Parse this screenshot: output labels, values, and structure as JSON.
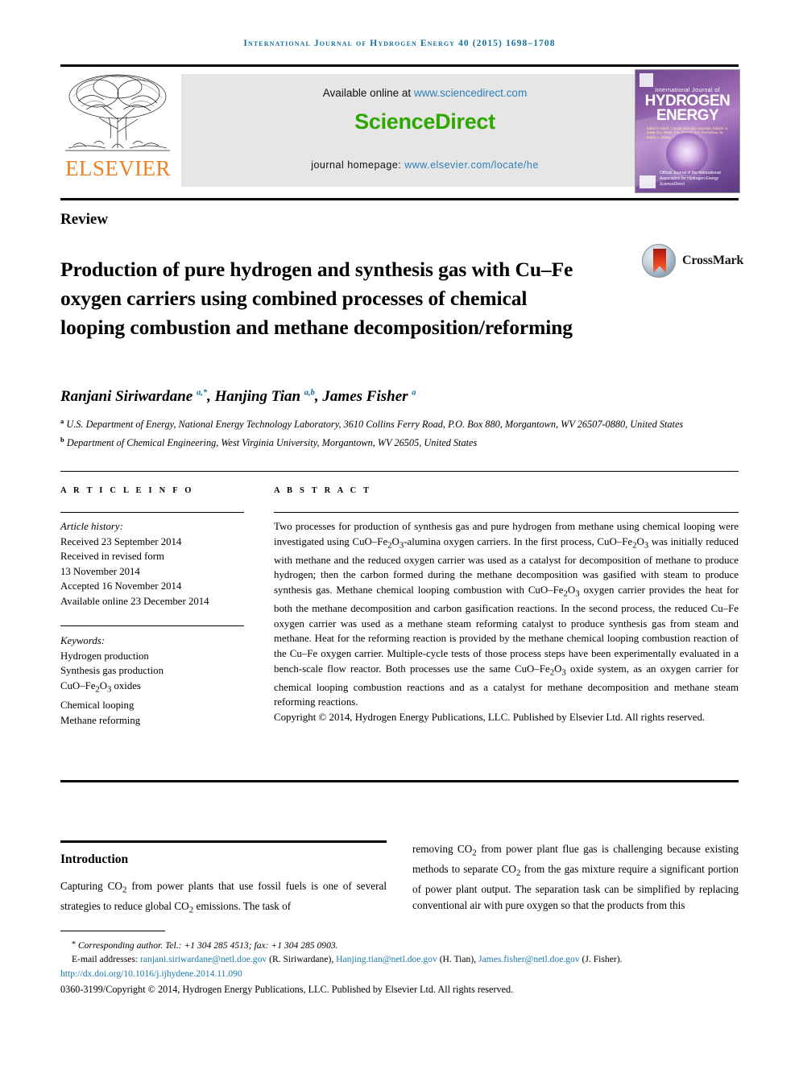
{
  "running_head": "International Journal of Hydrogen Energy 40 (2015) 1698–1708",
  "masthead": {
    "available_prefix": "Available online at ",
    "sciencedirect_url": "www.sciencedirect.com",
    "sciencedirect_logo": "ScienceDirect",
    "homepage_prefix": "journal homepage: ",
    "homepage_url": "www.elsevier.com/locate/he",
    "publisher": "ELSEVIER",
    "publisher_color": "#f08122",
    "sciencedirect_color": "#2ea700",
    "link_color": "#2c7fb8"
  },
  "cover": {
    "line1": "International Journal of",
    "line2": "HYDROGEN",
    "line3": "ENERGY",
    "editors": "Editor-in-Chief:  T. Nejat Veziroglu    Associate Editors:  S. Dutta, D.L. Block, F.M. Barreto, R.E. Rocheleau, M. Barbir, L. Zhang, Z.X. Liu, D. Stolten",
    "bottom": "Official Journal of the International Association for Hydrogen Energy    ScienceDirect"
  },
  "article": {
    "type": "Review",
    "title": "Production of pure hydrogen and synthesis gas with Cu–Fe oxygen carriers using combined processes of chemical looping combustion and methane decomposition/reforming",
    "crossmark_label": "CrossMark",
    "authors_html": "Ranjani Siriwardane <sup>a,*</sup>, Hanjing Tian <sup>a,b</sup>, James Fisher <sup>a</sup>",
    "affiliations": [
      {
        "marker": "a",
        "text": "U.S. Department of Energy, National Energy Technology Laboratory, 3610 Collins Ferry Road, P.O. Box 880, Morgantown, WV 26507-0880, United States"
      },
      {
        "marker": "b",
        "text": "Department of Chemical Engineering, West Virginia University, Morgantown, WV 26505, United States"
      }
    ]
  },
  "headings": {
    "article_info": "A R T I C L E   I N F O",
    "abstract": "A B S T R A C T"
  },
  "history": {
    "label": "Article history:",
    "lines": [
      "Received 23 September 2014",
      "Received in revised form",
      "13 November 2014",
      "Accepted 16 November 2014",
      "Available online 23 December 2014"
    ]
  },
  "keywords": {
    "label": "Keywords:",
    "items": [
      "Hydrogen production",
      "Synthesis gas production",
      "CuO–Fe2O3 oxides",
      "Chemical looping",
      "Methane reforming"
    ],
    "cuo_fe2o3_html": "CuO–Fe<sub>2</sub>O<sub>3</sub> oxides"
  },
  "abstract": {
    "body_html": "Two processes for production of synthesis gas and pure hydrogen from methane using chemical looping were investigated using CuO–Fe<sub>2</sub>O<sub>3</sub>-alumina oxygen carriers. In the first process, CuO–Fe<sub>2</sub>O<sub>3</sub> was initially reduced with methane and the reduced oxygen carrier was used as a catalyst for decomposition of methane to produce hydrogen; then the carbon formed during the methane decomposition was gasified with steam to produce synthesis gas. Methane chemical looping combustion with CuO–Fe<sub>2</sub>O<sub>3</sub> oxygen carrier provides the heat for both the methane decomposition and carbon gasification reactions. In the second process, the reduced Cu–Fe oxygen carrier was used as a methane steam reforming catalyst to produce synthesis gas from steam and methane. Heat for the reforming reaction is provided by the methane chemical looping combustion reaction of the Cu–Fe oxygen carrier. Multiple-cycle tests of those process steps have been experimentally evaluated in a bench-scale flow reactor. Both processes use the same CuO–Fe<sub>2</sub>O<sub>3</sub> oxide system, as an oxygen carrier for chemical looping combustion reactions and as a catalyst for methane decomposition and methane steam reforming reactions.",
    "copyright": "Copyright © 2014, Hydrogen Energy Publications, LLC. Published by Elsevier Ltd. All rights reserved."
  },
  "body": {
    "intro_heading": "Introduction",
    "left_paragraph_html": "Capturing CO<sub>2</sub> from power plants that use fossil fuels is one of several strategies to reduce global CO<sub>2</sub> emissions. The task of",
    "right_paragraph_html": "removing CO<sub>2</sub> from power plant flue gas is challenging because existing methods to separate CO<sub>2</sub> from the gas mixture require a significant portion of power plant output. The separation task can be simplified by replacing conventional air with pure oxygen so that the products from this"
  },
  "footnotes": {
    "corresponding": "Corresponding author. Tel.: +1 304 285 4513; fax: +1 304 285 0903.",
    "emails_label": "E-mail addresses:",
    "emails": [
      {
        "address": "ranjani.siriwardane@netl.doe.gov",
        "name": "(R. Siriwardane)"
      },
      {
        "address": "Hanjing.tian@netl.doe.gov",
        "name": "(H. Tian)"
      },
      {
        "address": "James.fisher@netl.doe.gov",
        "name": "(J. Fisher)."
      }
    ],
    "doi": "http://dx.doi.org/10.1016/j.ijhydene.2014.11.090",
    "issn_line": "0360-3199/Copyright © 2014, Hydrogen Energy Publications, LLC. Published by Elsevier Ltd. All rights reserved.",
    "link_color": "#1a7aa8"
  }
}
